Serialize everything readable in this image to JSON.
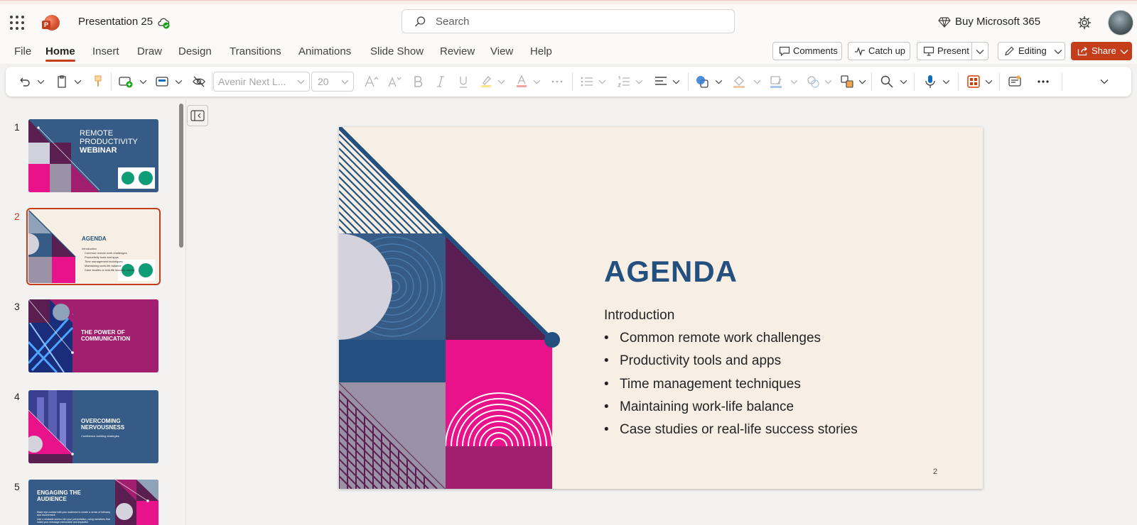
{
  "app": {
    "document_title": "Presentation 25",
    "search_placeholder": "Search",
    "buy_label": "Buy Microsoft 365"
  },
  "menu": {
    "tabs": [
      "File",
      "Home",
      "Insert",
      "Draw",
      "Design",
      "Transitions",
      "Animations",
      "Slide Show",
      "Review",
      "View",
      "Help"
    ],
    "active_tab": "Home"
  },
  "actions": {
    "comments": "Comments",
    "catch_up": "Catch up",
    "present": "Present",
    "editing": "Editing",
    "share": "Share"
  },
  "ribbon": {
    "font_name": "Avenir Next L...",
    "font_size": "20"
  },
  "thumbnails": [
    {
      "number": "1",
      "title_line1": "REMOTE",
      "title_line2": "PRODUCTIVITY",
      "title_line3": "WEBINAR"
    },
    {
      "number": "2",
      "title": "AGENDA",
      "intro": "Introduction",
      "bullets": [
        "Common remote work challenges",
        "Productivity tools and apps",
        "Time management techniques",
        "Maintaining work-life balance",
        "Case studies or real-life success stories"
      ]
    },
    {
      "number": "3",
      "title_line1": "THE POWER OF",
      "title_line2": "COMMUNICATION"
    },
    {
      "number": "4",
      "title_line1": "OVERCOMING",
      "title_line2": "NERVOUSNESS",
      "subtitle": "Confidence-building strategies"
    },
    {
      "number": "5",
      "title_line1": "ENGAGING THE",
      "title_line2": "AUDIENCE",
      "body": "Make eye contact with your audience to create a sense of intimacy and involvement",
      "body2": "Use a relatable stories into your presentation, using narratives that make your message memorable and impactful"
    }
  ],
  "slide": {
    "title": "AGENDA",
    "intro": "Introduction",
    "bullets": [
      "Common remote work challenges",
      "Productivity tools and apps",
      "Time management techniques",
      "Maintaining work-life balance",
      "Case studies or real-life success stories"
    ],
    "page_number": "2"
  },
  "colors": {
    "accent": "#c43e1c",
    "slide_navy": "#24507f",
    "slide_magenta": "#e8138a",
    "slide_plum": "#5a1f50",
    "slide_cream": "#f7efe3"
  }
}
